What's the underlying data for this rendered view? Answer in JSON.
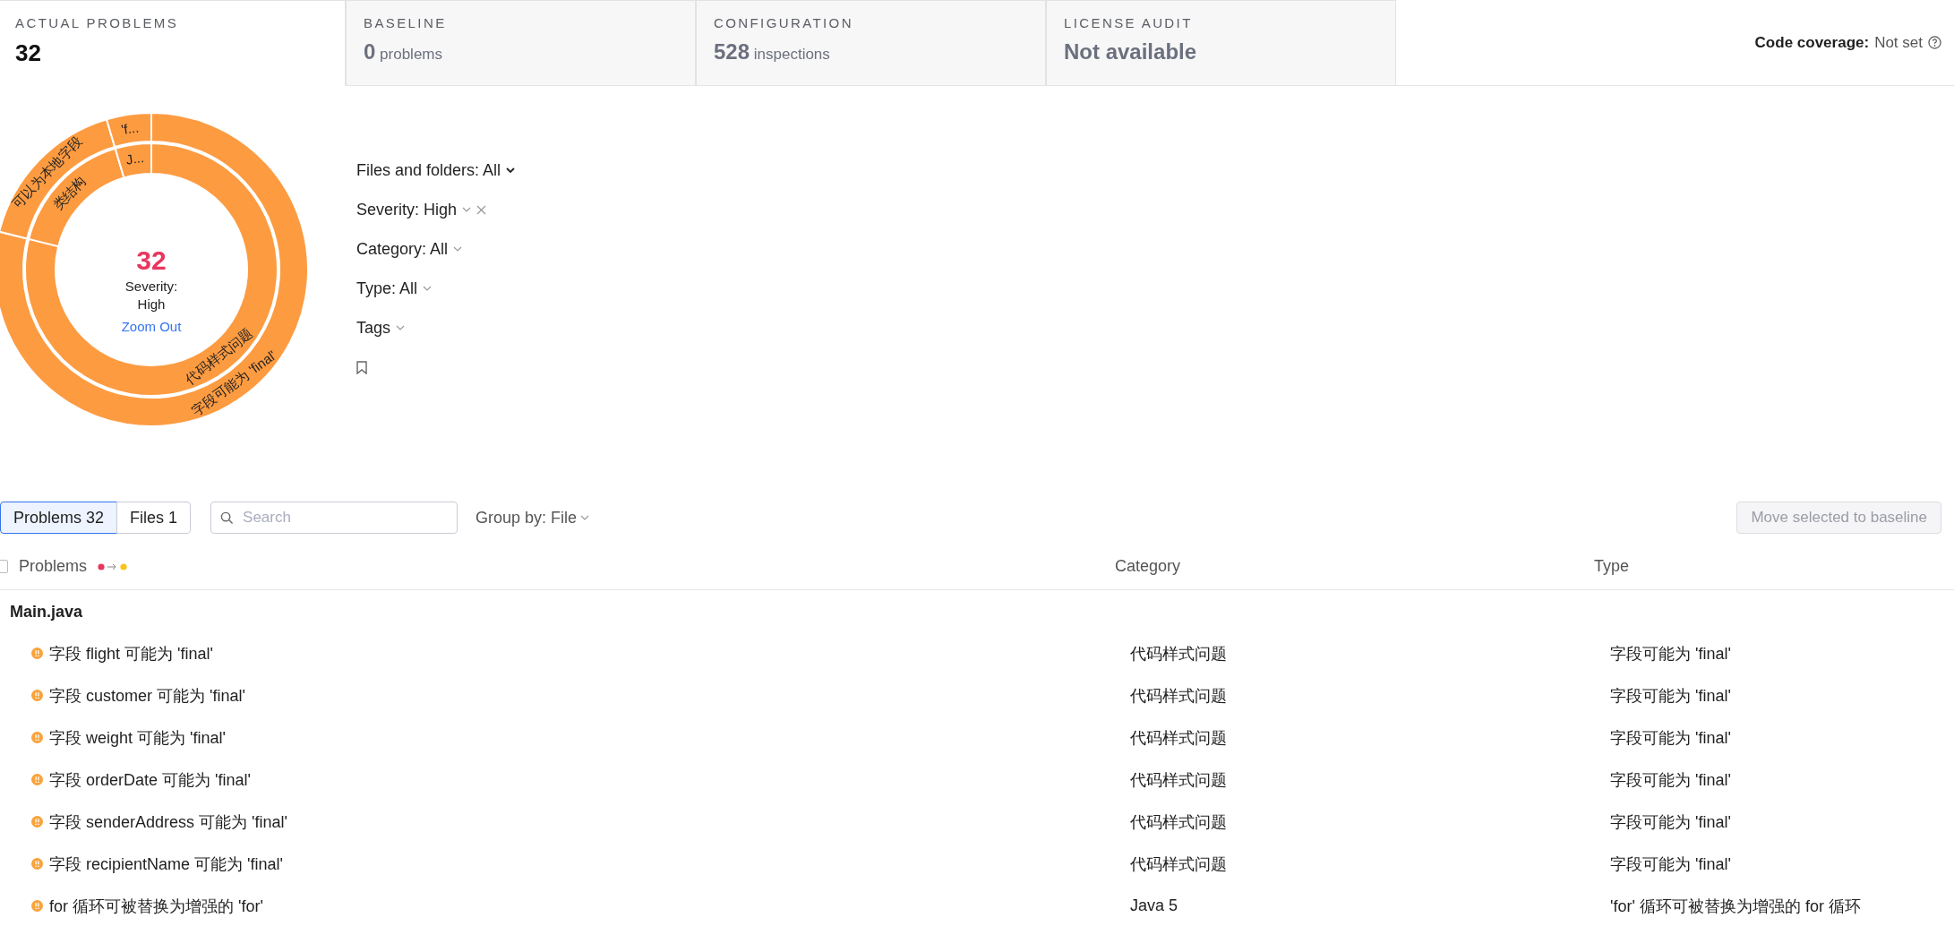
{
  "tabs": [
    {
      "label": "ACTUAL PROBLEMS",
      "value": "32",
      "selected": true
    },
    {
      "label": "BASELINE",
      "value": "0",
      "unit": "problems",
      "selected": false
    },
    {
      "label": "CONFIGURATION",
      "value": "528",
      "unit": "inspections",
      "selected": false
    },
    {
      "label": "LICENSE AUDIT",
      "value": "Not available",
      "selected": false
    }
  ],
  "code_coverage": {
    "label": "Code coverage:",
    "value": "Not set"
  },
  "sunburst": {
    "count": "32",
    "caption": "Severity: High",
    "link": "Zoom Out",
    "segments": [
      {
        "kind": "outer",
        "label": "字段可能为 'final'"
      },
      {
        "kind": "outer",
        "label": "可以为本地字段"
      },
      {
        "kind": "outer",
        "label": "'f..."
      },
      {
        "kind": "inner",
        "label": "代码样式问题"
      },
      {
        "kind": "inner",
        "label": "类结构"
      },
      {
        "kind": "inner",
        "label": "J..."
      }
    ]
  },
  "filters": [
    {
      "label": "Files and folders: All",
      "removable": false
    },
    {
      "label": "Severity: High",
      "removable": true
    },
    {
      "label": "Category: All",
      "removable": false
    },
    {
      "label": "Type: All",
      "removable": false
    },
    {
      "label": "Tags",
      "removable": false
    }
  ],
  "toolbar": {
    "views": [
      {
        "label": "Problems 32",
        "selected": true
      },
      {
        "label": "Files 1",
        "selected": false
      }
    ],
    "search": {
      "placeholder": "Search"
    },
    "group_by": "Group by: File",
    "move_button": {
      "label": "Move selected to baseline",
      "disabled": true
    }
  },
  "table": {
    "select_all": {
      "checked": false
    },
    "columns": [
      "Problems",
      "Category",
      "Type"
    ],
    "groups": [
      {
        "name": "Main.java",
        "rows": [
          {
            "problem": "字段 flight 可能为 'final'",
            "category": "代码样式问题",
            "type": "字段可能为 'final'"
          },
          {
            "problem": "字段 customer 可能为 'final'",
            "category": "代码样式问题",
            "type": "字段可能为 'final'"
          },
          {
            "problem": "字段 weight 可能为 'final'",
            "category": "代码样式问题",
            "type": "字段可能为 'final'"
          },
          {
            "problem": "字段 orderDate 可能为 'final'",
            "category": "代码样式问题",
            "type": "字段可能为 'final'"
          },
          {
            "problem": "字段 senderAddress 可能为 'final'",
            "category": "代码样式问题",
            "type": "字段可能为 'final'"
          },
          {
            "problem": "字段 recipientName 可能为 'final'",
            "category": "代码样式问题",
            "type": "字段可能为 'final'"
          },
          {
            "problem": "for 循环可被替换为增强的 'for'",
            "category": "Java 5",
            "type": "'for' 循环可被替换为增强的 for 循环"
          }
        ]
      }
    ]
  }
}
